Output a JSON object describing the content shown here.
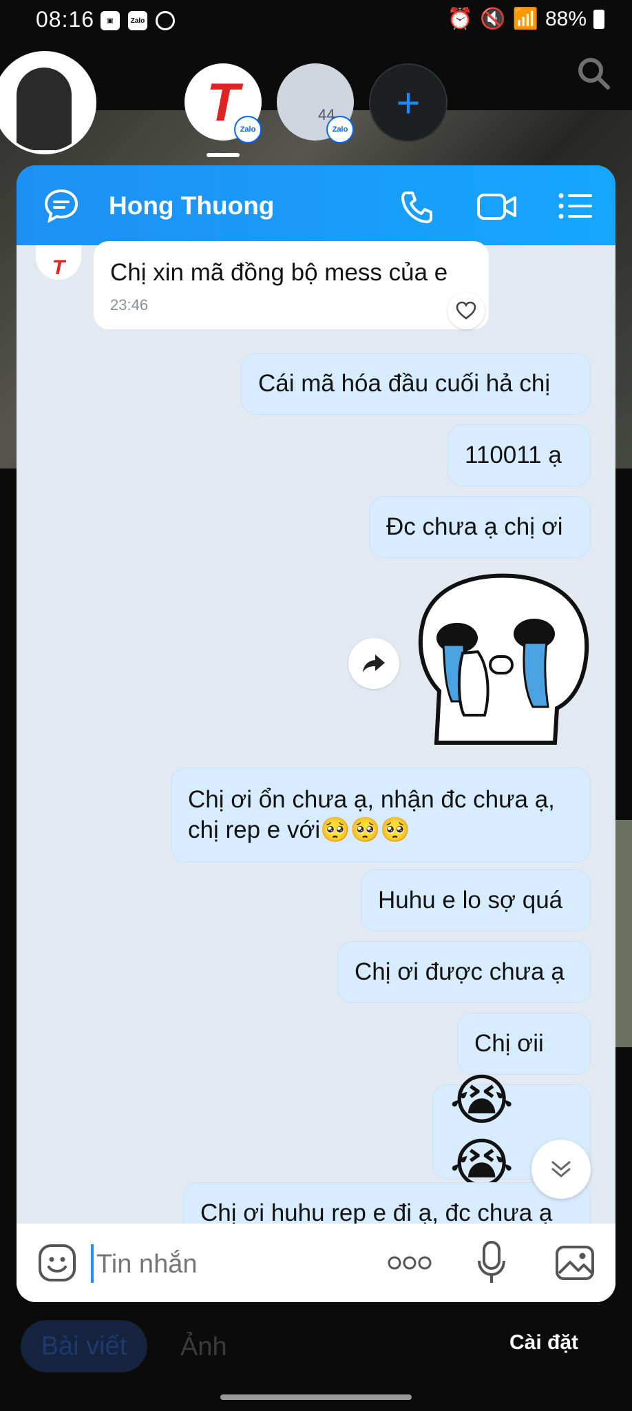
{
  "status_bar": {
    "time": "08:16",
    "battery": "88%"
  },
  "stories": {
    "group_count": "44",
    "badge": "Zalo",
    "add": "+"
  },
  "chat": {
    "title": "Hong Thuong",
    "messages": [
      {
        "side": "in",
        "text": "Chị xin mã đồng bộ mess của e",
        "time": "23:46"
      },
      {
        "side": "out",
        "text": "Cái mã hóa đầu cuối hả chị"
      },
      {
        "side": "out",
        "text": "110011 ạ"
      },
      {
        "side": "out",
        "text": "Đc chưa ạ chị ơi"
      },
      {
        "side": "out",
        "text": "Chị ơi ổn chưa ạ, nhận đc chưa ạ,",
        "text2": "chị rep e với🥺🥺🥺"
      },
      {
        "side": "out",
        "text": "Huhu e lo sợ quá"
      },
      {
        "side": "out",
        "text": "Chị ơi được chưa ạ"
      },
      {
        "side": "out",
        "text": "Chị ơii"
      },
      {
        "side": "out",
        "text": "😭😭"
      },
      {
        "side": "out",
        "text": "Chị ơi huhu rep e đi ạ, đc chưa ạ"
      }
    ],
    "input_placeholder": "Tin nhắn"
  },
  "profile_tabs": {
    "posts": "Bài viết",
    "photos": "Ảnh",
    "settings": "Cài đặt"
  },
  "colors": {
    "header": "#1d90f5",
    "outgoing_bubble": "#d8ecff",
    "chat_bg": "#e2e9f1"
  }
}
